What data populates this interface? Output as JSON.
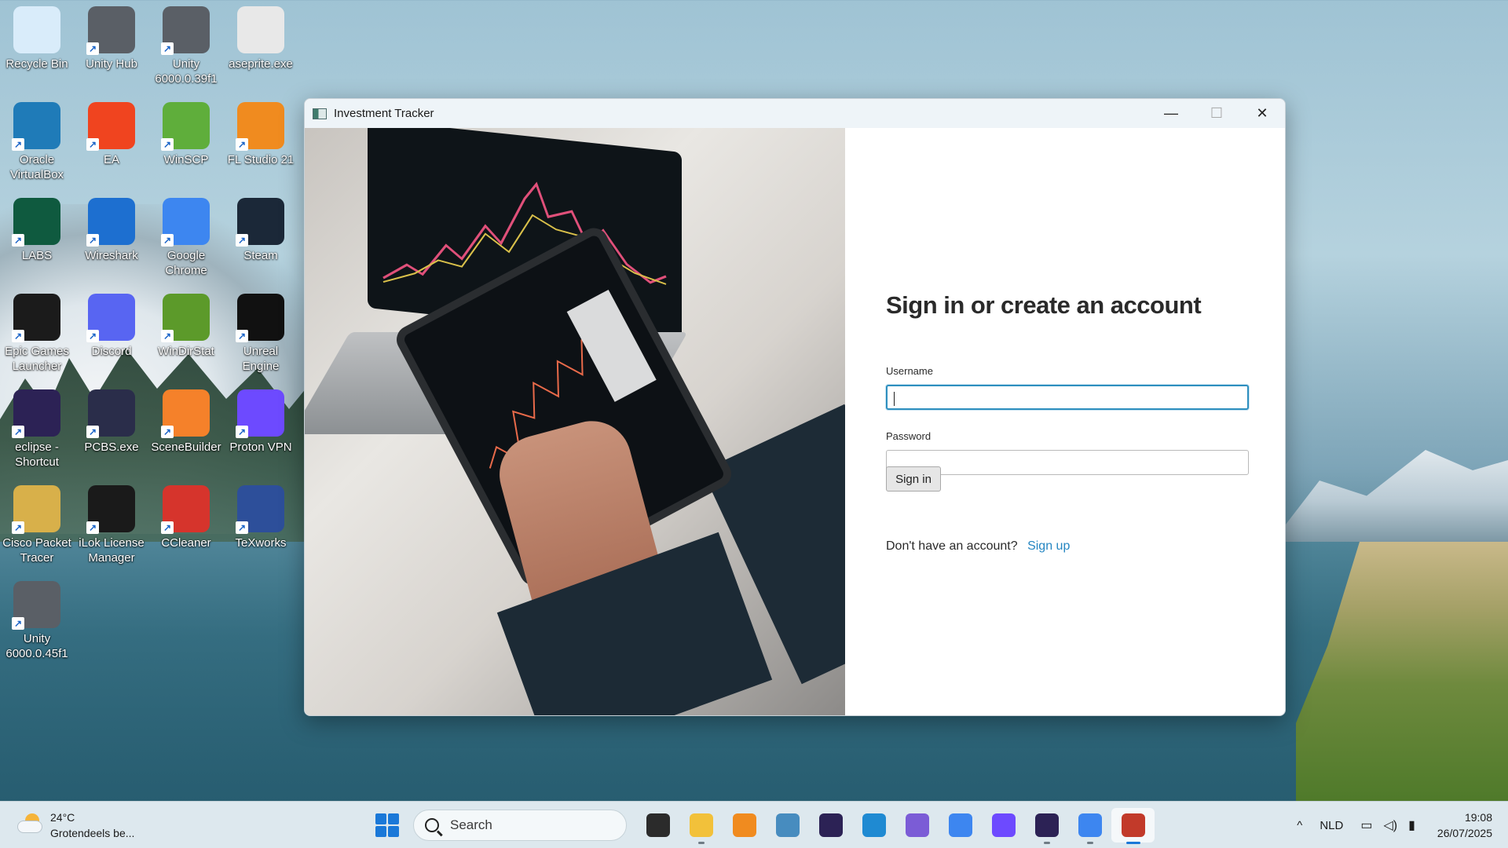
{
  "desktop": {
    "icons": [
      {
        "label": "Recycle Bin",
        "icon": "recycle-bin-icon",
        "color": "#d9ecfa"
      },
      {
        "label": "Unity Hub",
        "icon": "unity-hub-icon",
        "color": "#5a5f66"
      },
      {
        "label": "Unity 6000.0.39f1",
        "icon": "unity-icon",
        "color": "#5a5f66"
      },
      {
        "label": "aseprite.exe",
        "icon": "aseprite-icon",
        "color": "#e8e8e8"
      },
      {
        "label": "Oracle VirtualBox",
        "icon": "virtualbox-icon",
        "color": "#1f7bb8"
      },
      {
        "label": "EA",
        "icon": "ea-icon",
        "color": "#f0441f"
      },
      {
        "label": "WinSCP",
        "icon": "winscp-icon",
        "color": "#5fae3b"
      },
      {
        "label": "FL Studio 21",
        "icon": "fl-studio-icon",
        "color": "#f08b1f"
      },
      {
        "label": "LABS",
        "icon": "labs-icon",
        "color": "#0f5a3f"
      },
      {
        "label": "Wireshark",
        "icon": "wireshark-icon",
        "color": "#1d6fd0"
      },
      {
        "label": "Google Chrome",
        "icon": "chrome-icon",
        "color": "#3d86f0"
      },
      {
        "label": "Steam",
        "icon": "steam-icon",
        "color": "#1b2838"
      },
      {
        "label": "Epic Games Launcher",
        "icon": "epic-games-icon",
        "color": "#1b1b1b"
      },
      {
        "label": "Discord",
        "icon": "discord-icon",
        "color": "#5865f2"
      },
      {
        "label": "WinDirStat",
        "icon": "windirstat-icon",
        "color": "#5c9a2a"
      },
      {
        "label": "Unreal Engine",
        "icon": "unreal-engine-icon",
        "color": "#111111"
      },
      {
        "label": "eclipse - Shortcut",
        "icon": "eclipse-icon",
        "color": "#2c2255"
      },
      {
        "label": "PCBS.exe",
        "icon": "pcbs-icon",
        "color": "#2a2d4a"
      },
      {
        "label": "SceneBuilder",
        "icon": "scenebuilder-icon",
        "color": "#f5812a"
      },
      {
        "label": "Proton VPN",
        "icon": "proton-vpn-icon",
        "color": "#6d4aff"
      },
      {
        "label": "Cisco Packet Tracer",
        "icon": "cisco-packet-tracer-icon",
        "color": "#d8b04a"
      },
      {
        "label": "iLok License Manager",
        "icon": "ilok-icon",
        "color": "#1a1a1a"
      },
      {
        "label": "CCleaner",
        "icon": "ccleaner-icon",
        "color": "#d6342c"
      },
      {
        "label": "TeXworks",
        "icon": "texworks-icon",
        "color": "#2d4f9a"
      },
      {
        "label": "Unity 6000.0.45f1",
        "icon": "unity-icon",
        "color": "#5a5f66"
      }
    ]
  },
  "window": {
    "title": "Investment Tracker",
    "controls": {
      "minimize": "—",
      "maximize": "☐",
      "close": "✕"
    }
  },
  "login": {
    "heading": "Sign in or create an account",
    "username_label": "Username",
    "username_value": "",
    "password_label": "Password",
    "password_value": "",
    "signin_label": "Sign in",
    "signup_prompt": "Don't have an account?",
    "signup_link": "Sign up",
    "accent_color": "#2586c2"
  },
  "taskbar": {
    "weather_temp": "24°C",
    "weather_desc": "Grotendeels be...",
    "search_label": "Search",
    "apps": [
      {
        "name": "task-view-icon",
        "color": "#2b2b2b",
        "open": false
      },
      {
        "name": "file-explorer-icon",
        "color": "#f2c13a",
        "open": true
      },
      {
        "name": "fl-studio-taskbar-icon",
        "color": "#f08b1f",
        "open": false
      },
      {
        "name": "godot-icon",
        "color": "#478cbf",
        "open": false
      },
      {
        "name": "eclipse-taskbar-icon",
        "color": "#2c2255",
        "open": false
      },
      {
        "name": "vscode-icon",
        "color": "#1f8ad2",
        "open": false
      },
      {
        "name": "m365-icon",
        "color": "#7b5cd6",
        "open": false
      },
      {
        "name": "chrome-taskbar-icon",
        "color": "#3d86f0",
        "open": false
      },
      {
        "name": "proton-pass-icon",
        "color": "#6d4aff",
        "open": false
      },
      {
        "name": "eclipse-taskbar-icon-2",
        "color": "#2c2255",
        "open": true
      },
      {
        "name": "chrome-taskbar-icon-2",
        "color": "#3d86f0",
        "open": true
      },
      {
        "name": "java-app-icon",
        "color": "#c23a2a",
        "open": true,
        "active": true
      }
    ],
    "tray_chevron": "^",
    "language": "NLD",
    "time": "19:08",
    "date": "26/07/2025"
  }
}
